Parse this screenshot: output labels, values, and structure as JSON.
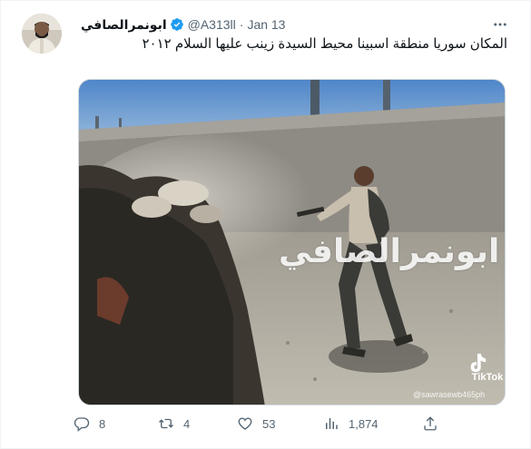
{
  "tweet": {
    "author": {
      "display_name": "ابونمرالصافي",
      "handle": "@A313ll",
      "verified": true
    },
    "date": "Jan 13",
    "separator": "·",
    "text": "المكان سوريا منطقة اسبينا محيط السيدة زينب عليها السلام ٢٠١٢",
    "media": {
      "watermark": "ابونمرالصافي",
      "tiktok_label": "TikTok",
      "tiktok_user": "@sawrasewb465ph"
    },
    "actions": {
      "replies": "8",
      "retweets": "4",
      "likes": "53",
      "views": "1,874"
    }
  },
  "colors": {
    "verified_badge": "#1d9bf0",
    "secondary_text": "#536471",
    "primary_text": "#0f1419"
  },
  "icons": [
    "more-icon",
    "verified-badge-icon",
    "reply-icon",
    "retweet-icon",
    "like-icon",
    "views-icon",
    "share-icon",
    "tiktok-logo-icon"
  ]
}
